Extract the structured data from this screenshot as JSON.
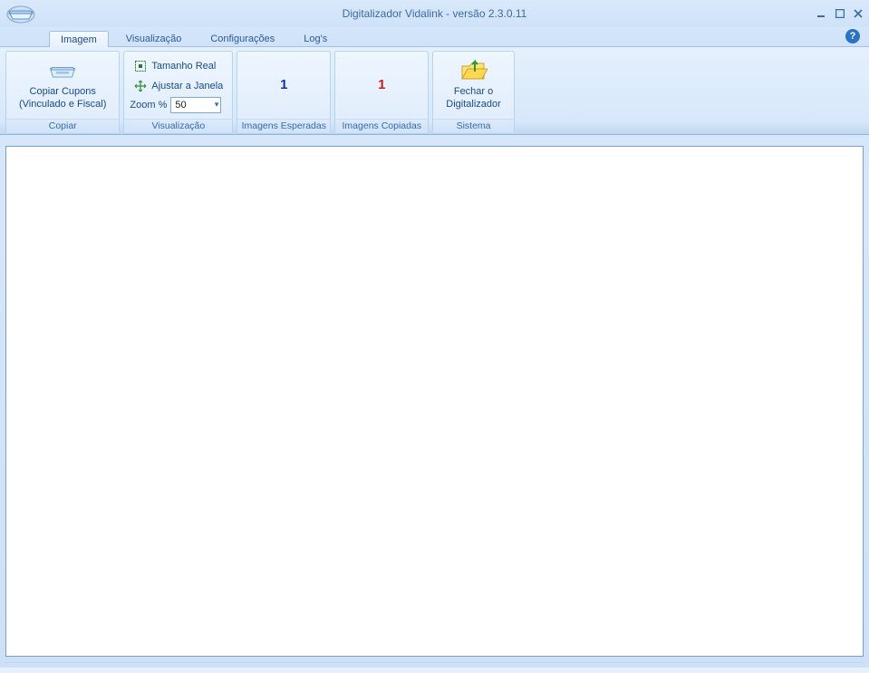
{
  "window": {
    "title": "Digitalizador Vidalink - versão 2.3.0.11"
  },
  "tabs": {
    "imagem": "Imagem",
    "visualizacao": "Visualização",
    "configuracoes": "Configurações",
    "logs": "Log's"
  },
  "ribbon": {
    "copiar": {
      "btn_line1": "Copiar Cupons",
      "btn_line2": "(Vinculado e Fiscal)",
      "group_label": "Copiar"
    },
    "visualizacao": {
      "tamanho_real": "Tamanho Real",
      "ajustar_janela": "Ajustar a Janela",
      "zoom_label": "Zoom %",
      "zoom_value": "50",
      "group_label": "Visualização"
    },
    "esperadas": {
      "count": "1",
      "group_label": "Imagens Esperadas"
    },
    "copiadas": {
      "count": "1",
      "group_label": "Imagens Copiadas"
    },
    "sistema": {
      "btn_line1": "Fechar o",
      "btn_line2": "Digitalizador",
      "group_label": "Sistema"
    }
  }
}
